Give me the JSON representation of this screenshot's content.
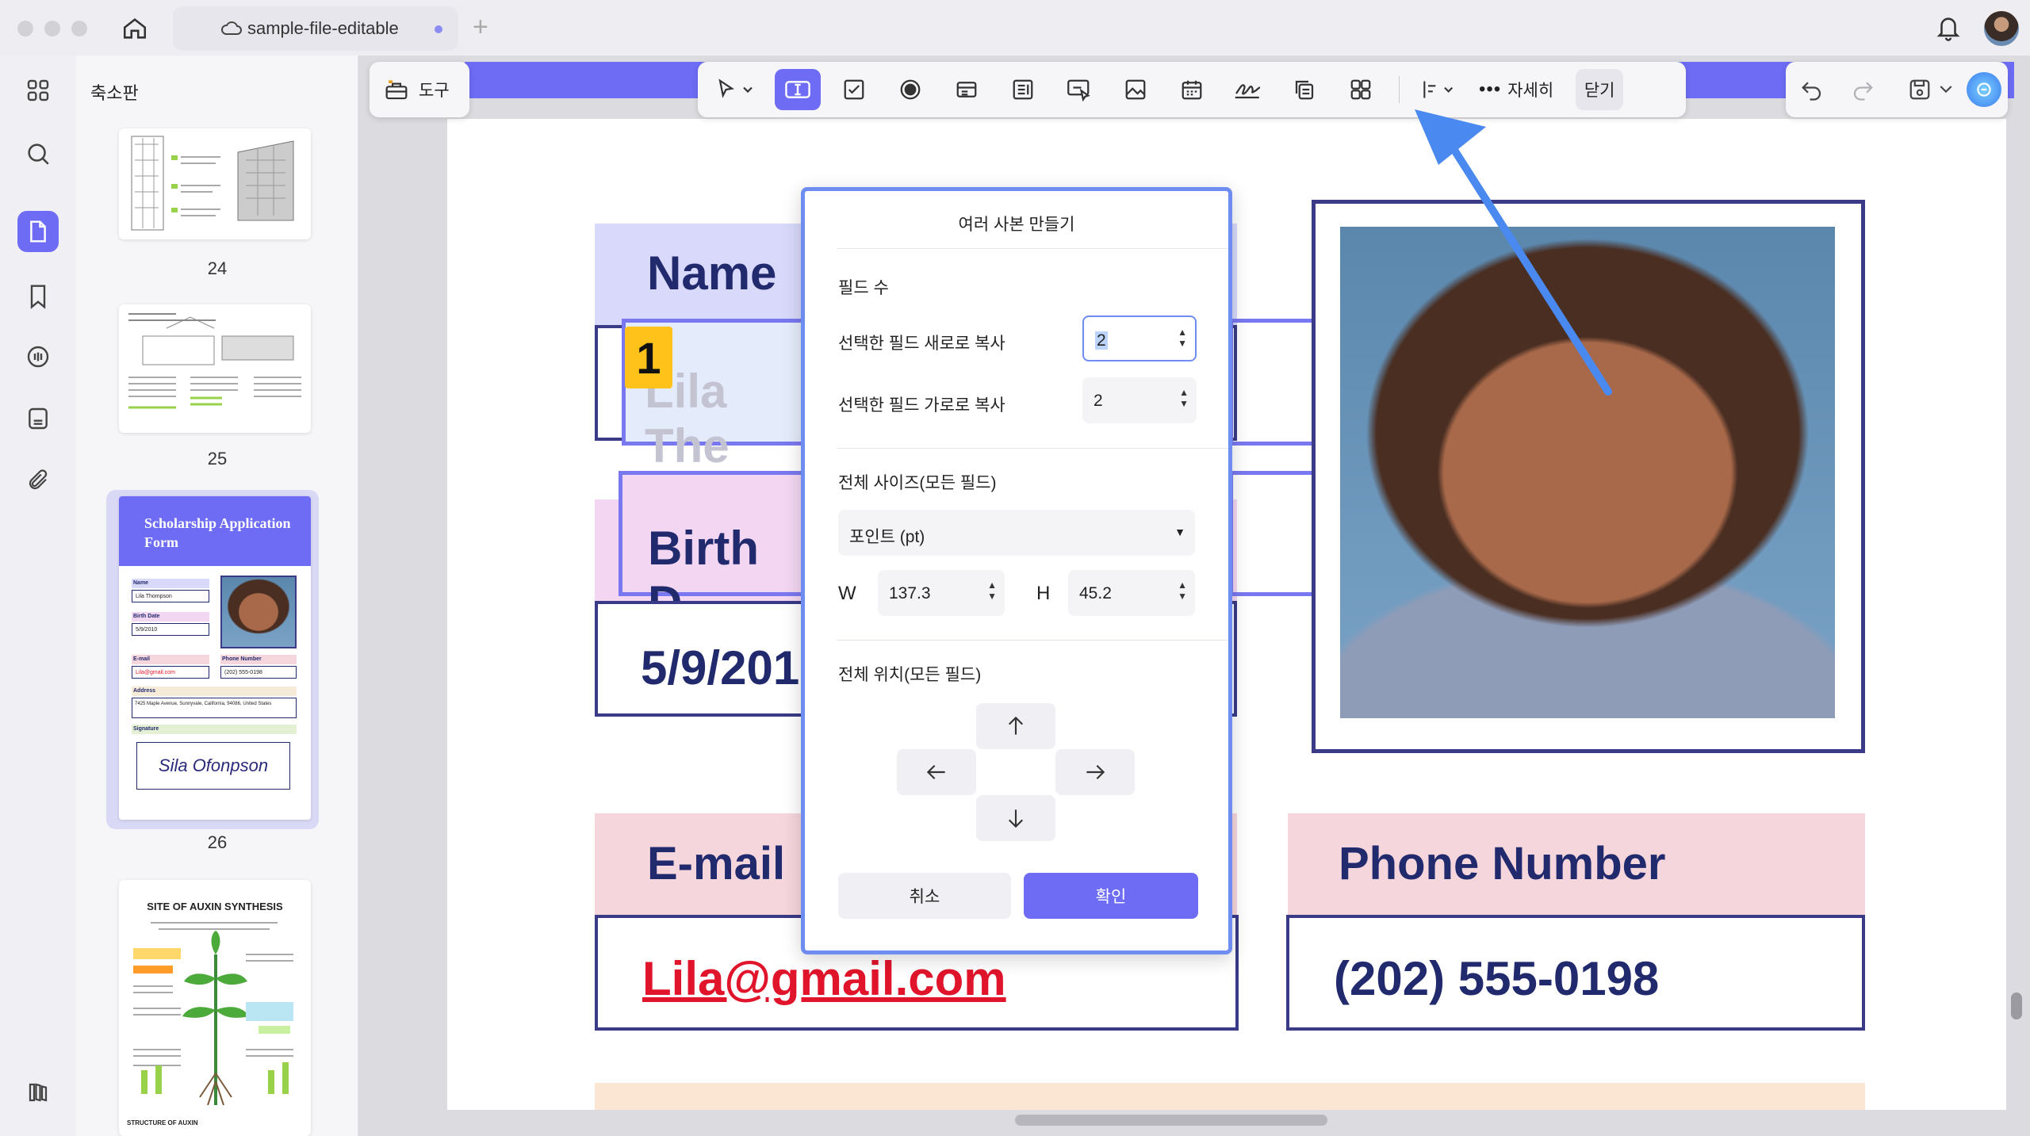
{
  "window": {
    "tab_title": "sample-file-editable",
    "add_tab": "+"
  },
  "sidebar": {
    "title": "축소판",
    "pages": [
      "24",
      "25",
      "26"
    ],
    "thumb26": {
      "title": "Scholarship Application Form",
      "name_label": "Name",
      "name_value": "Lila Thompson",
      "birth_label": "Birth Date",
      "birth_value": "5/9/2010",
      "email_label": "E-mail",
      "email_value": "Lila@gmail.com",
      "phone_label": "Phone Number",
      "phone_value": "(202) 555-0198",
      "address_label": "Address",
      "address_value": "7425 Maple Avenue, Sunnyvale, California, 94086, United States",
      "signature_label": "Signature",
      "signature_value": "Sila Ofonpson"
    },
    "thumb27_title": "SITE OF AUXIN SYNTHESIS",
    "thumb27_footer": "STRUCTURE OF AUXIN"
  },
  "toolbar": {
    "tools_label": "도구",
    "more_label": "자세히",
    "close_label": "닫기",
    "icons": [
      "cursor-icon",
      "text-field-icon",
      "checkbox-icon",
      "radio-icon",
      "combo-box-icon",
      "list-box-icon",
      "button-icon",
      "image-field-icon",
      "date-field-icon",
      "signature-icon",
      "copy-icon",
      "multiple-copies-icon",
      "align-icon"
    ]
  },
  "form": {
    "name_label": "Name",
    "name_value": "Lila The",
    "birth_label": "Birth D",
    "birth_value": "5/9/201",
    "email_label": "E-mail",
    "email_value": "Lila@gmail.com",
    "phone_label": "Phone Number",
    "phone_value": "(202) 555-0198",
    "badge": "1"
  },
  "dialog": {
    "title": "여러 사본 만들기",
    "field_count_heading": "필드 수",
    "vertical_label": "선택한 필드 새로로 복사",
    "vertical_value": "2",
    "horizontal_label": "선택한 필드 가로로 복사",
    "horizontal_value": "2",
    "size_heading": "전체 사이즈(모든 필드)",
    "unit_value": "포인트 (pt)",
    "w_label": "W",
    "w_value": "137.3",
    "h_label": "H",
    "h_value": "45.2",
    "position_heading": "전체 위치(모든 필드)",
    "cancel_label": "취소",
    "ok_label": "확인"
  },
  "colors": {
    "accent": "#6e6cf5",
    "form_navy": "#222a6e",
    "email_red": "#e0152b",
    "name_bg": "#d9d9fb",
    "birth_bg": "#f3d7f2",
    "email_bg": "#f6d6dd",
    "badge": "#ffc21a",
    "arrow": "#4a8af0"
  }
}
